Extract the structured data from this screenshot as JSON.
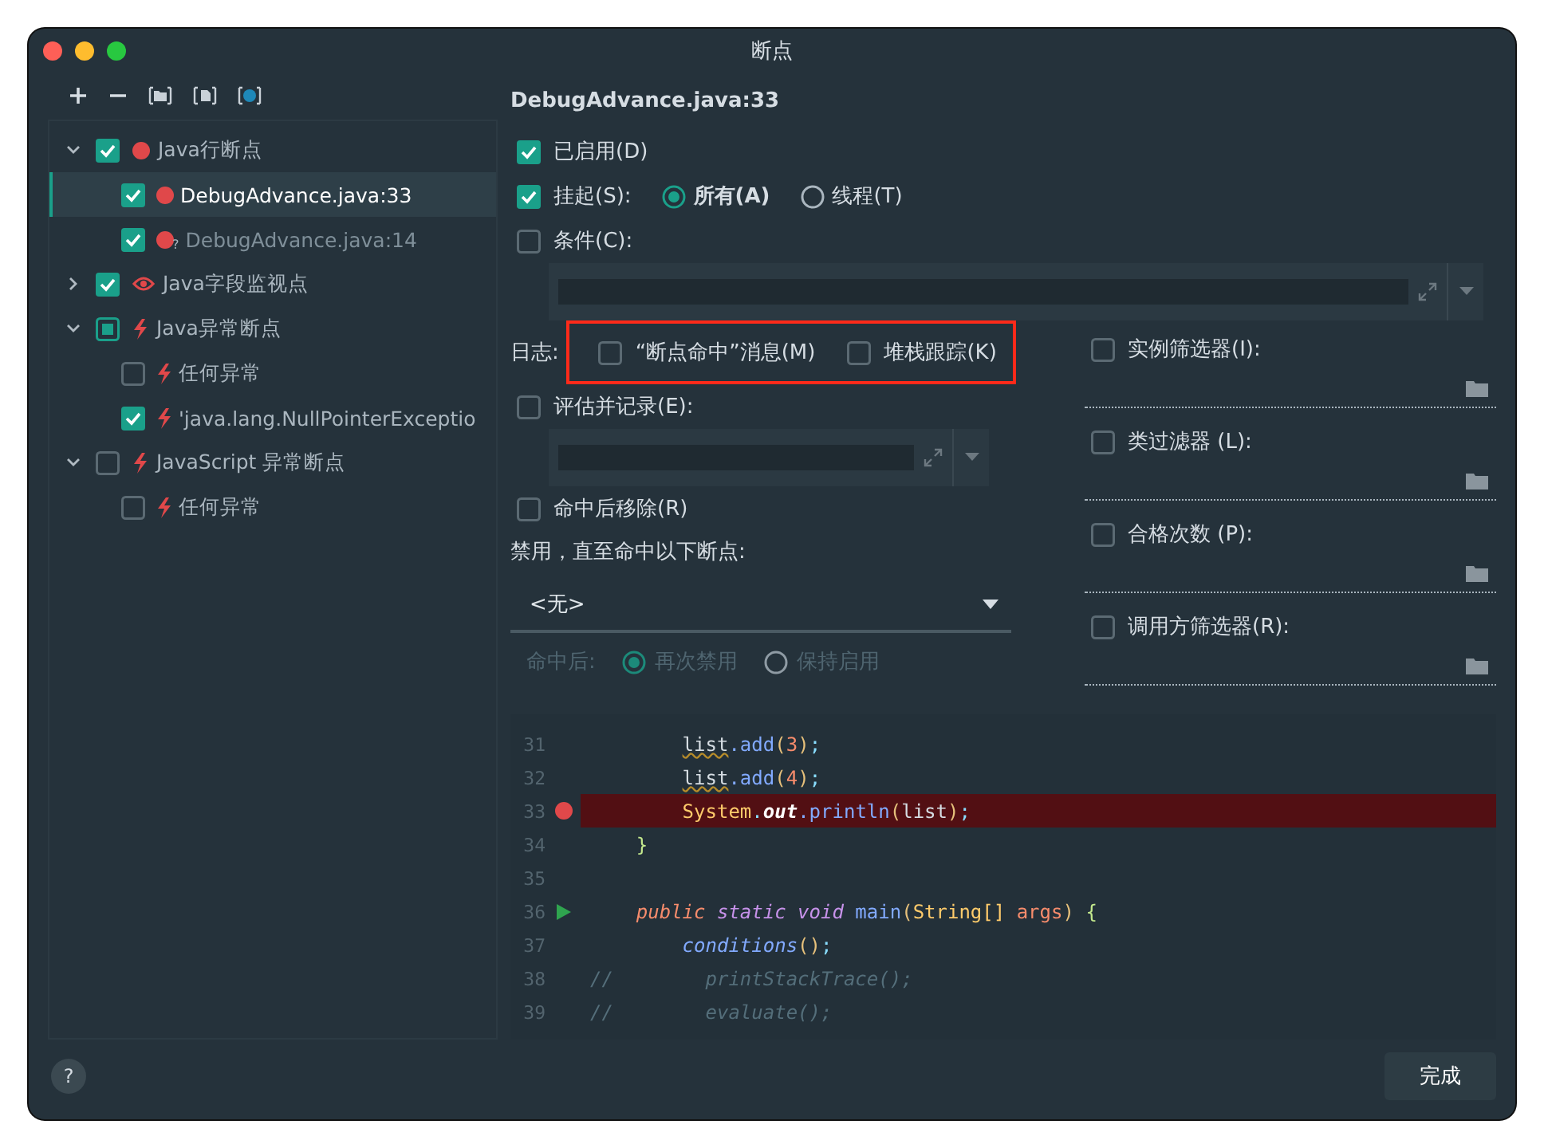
{
  "window": {
    "title": "断点"
  },
  "toolbar": [
    {
      "kind": "plus"
    },
    {
      "kind": "minus"
    },
    {
      "kind": "folder"
    },
    {
      "kind": "file"
    },
    {
      "kind": "class"
    }
  ],
  "tree": [
    {
      "label": "Java行断点",
      "kind": "line",
      "checked": true,
      "expanded": true,
      "selected": false,
      "children": [
        {
          "label": "DebugAdvance.java:33",
          "kind": "line",
          "checked": true,
          "selected": true
        },
        {
          "label": "DebugAdvance.java:14",
          "kind": "line",
          "badge": "?",
          "checked": true,
          "selected": false
        }
      ]
    },
    {
      "label": "Java字段监视点",
      "kind": "watch",
      "checked": true,
      "expanded": false,
      "selected": false
    },
    {
      "label": "Java异常断点",
      "kind": "exception",
      "partial": true,
      "expanded": true,
      "selected": false,
      "children": [
        {
          "label": "任何异常",
          "kind": "exception",
          "checked": false,
          "selected": false
        },
        {
          "label": "'java.lang.NullPointerExceptio",
          "kind": "exception",
          "checked": true,
          "selected": false
        }
      ]
    },
    {
      "label": "JavaScript 异常断点",
      "kind": "exception",
      "checked": false,
      "expanded": true,
      "selected": false,
      "children": [
        {
          "label": "任何异常",
          "kind": "exception",
          "checked": false,
          "selected": false
        }
      ]
    }
  ],
  "detail": {
    "title": "DebugAdvance.java:33",
    "enabled": {
      "label": "已启用(D)",
      "checked": true
    },
    "suspend": {
      "label": "挂起(S):",
      "checked": true,
      "options": [
        {
          "label": "所有(A)",
          "selected": true
        },
        {
          "label": "线程(T)",
          "selected": false
        }
      ]
    },
    "condition": {
      "label": "条件(C):",
      "checked": false
    },
    "log": {
      "label": "日志:",
      "options": [
        {
          "label": "“断点命中”消息(M)",
          "checked": false
        },
        {
          "label": "堆栈跟踪(K)",
          "checked": false
        }
      ]
    },
    "evaluate": {
      "label": "评估并记录(E):",
      "checked": false
    },
    "remove": {
      "label": "命中后移除(R)",
      "checked": false
    },
    "disable_until": {
      "label": "禁用，直至命中以下断点:",
      "value": "<无>"
    },
    "after_hit": {
      "label": "命中后:",
      "disabled": true,
      "options": [
        {
          "label": "再次禁用",
          "selected": true
        },
        {
          "label": "保持启用",
          "selected": false
        }
      ]
    },
    "filters": [
      {
        "label": "实例筛选器(I):",
        "checked": false
      },
      {
        "label": "类过滤器 (L):",
        "checked": false
      },
      {
        "label": "合格次数 (P):",
        "checked": false
      },
      {
        "label": "调用方筛选器(R):",
        "checked": false
      }
    ]
  },
  "code": [
    {
      "line": "31",
      "kind": "body",
      "highlight": false,
      "tokens": [
        {
          "text": "list",
          "kind": "var"
        },
        {
          "text": ".add",
          "kind": "method"
        },
        {
          "text": "(",
          "kind": "paren"
        },
        {
          "text": "3",
          "kind": "number"
        },
        {
          "text": ")",
          "kind": "paren"
        },
        {
          "text": ";",
          "kind": "punct"
        }
      ]
    },
    {
      "line": "32",
      "kind": "body",
      "highlight": false,
      "tokens": [
        {
          "text": "list",
          "kind": "var"
        },
        {
          "text": ".add",
          "kind": "method"
        },
        {
          "text": "(",
          "kind": "paren"
        },
        {
          "text": "4",
          "kind": "number"
        },
        {
          "text": ")",
          "kind": "paren"
        },
        {
          "text": ";",
          "kind": "punct"
        }
      ]
    },
    {
      "line": "33",
      "kind": "body",
      "gutter": {
        "kind": "breakpoint"
      },
      "highlight": true,
      "tokens": [
        {
          "text": "System",
          "kind": "type"
        },
        {
          "text": ".",
          "kind": "punct"
        },
        {
          "text": "out",
          "kind": "field"
        },
        {
          "text": ".println",
          "kind": "method"
        },
        {
          "text": "(",
          "kind": "paren"
        },
        {
          "text": "list",
          "kind": "plain"
        },
        {
          "text": ")",
          "kind": "paren"
        },
        {
          "text": ";",
          "kind": "punct"
        }
      ]
    },
    {
      "line": "34",
      "kind": "member",
      "highlight": false,
      "tokens": [
        {
          "text": "}",
          "kind": "brace"
        }
      ]
    },
    {
      "line": "35",
      "highlight": false
    },
    {
      "line": "36",
      "kind": "member",
      "gutter": {
        "kind": "run"
      },
      "highlight": false,
      "tokens": [
        {
          "text": "public",
          "kind": "modifier"
        },
        {
          "text": "static void",
          "kind": "keyword"
        },
        {
          "text": "main",
          "kind": "method"
        },
        {
          "text": "(",
          "kind": "paren"
        },
        {
          "text": "String[]",
          "kind": "type"
        },
        {
          "text": "args",
          "kind": "param"
        },
        {
          "text": ")",
          "kind": "paren"
        },
        {
          "text": "{",
          "kind": "brace"
        }
      ]
    },
    {
      "line": "37",
      "kind": "body",
      "highlight": false,
      "tokens": [
        {
          "text": "conditions",
          "kind": "call"
        },
        {
          "text": "()",
          "kind": "paren"
        },
        {
          "text": ";",
          "kind": "punct"
        }
      ]
    },
    {
      "line": "38",
      "kind": "commented",
      "highlight": false,
      "tokens": [
        {
          "text": "//",
          "kind": "comment"
        },
        {
          "text": "printStackTrace();",
          "kind": "comment"
        }
      ]
    },
    {
      "line": "39",
      "kind": "commented",
      "highlight": false,
      "tokens": [
        {
          "text": "//",
          "kind": "comment"
        },
        {
          "text": "evaluate();",
          "kind": "comment"
        }
      ]
    }
  ],
  "help": {
    "label": "?"
  },
  "done_button": {
    "label": "完成"
  }
}
